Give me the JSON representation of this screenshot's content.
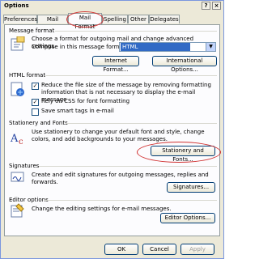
{
  "window": {
    "title": "Options",
    "help_glyph": "?",
    "close_glyph": "×"
  },
  "tabs": [
    "Preferences",
    "Mail Setup",
    "Mail Format",
    "Spelling",
    "Other",
    "Delegates"
  ],
  "message_format": {
    "heading": "Message format",
    "desc": "Choose a format for outgoing mail and change advanced settings.",
    "compose_label": "Compose in this message format:",
    "format_value": "HTML",
    "internet_format_button": "Internet Format...",
    "international_options_button": "International Options..."
  },
  "html_format": {
    "heading": "HTML format",
    "options": [
      {
        "label": "Reduce the file size of the message by removing formatting information that is not necessary to display the e-mail message",
        "checked": true
      },
      {
        "label": "Rely on CSS for font formatting",
        "checked": true
      },
      {
        "label": "Save smart tags in e-mail",
        "checked": false
      }
    ]
  },
  "stationery": {
    "heading": "Stationery and Fonts",
    "desc": "Use stationery to change your default font and style, change colors, and add backgrounds to your messages.",
    "button": "Stationery and Fonts..."
  },
  "signatures": {
    "heading": "Signatures",
    "desc": "Create and edit signatures for outgoing messages, replies and forwards.",
    "button": "Signatures..."
  },
  "editor_options": {
    "heading": "Editor options",
    "desc": "Change the editing settings for e-mail messages.",
    "button": "Editor Options..."
  },
  "footer": {
    "ok": "OK",
    "cancel": "Cancel",
    "apply": "Apply"
  },
  "colors": {
    "highlight_circle": "#d03030",
    "selection": "#316ac5"
  }
}
